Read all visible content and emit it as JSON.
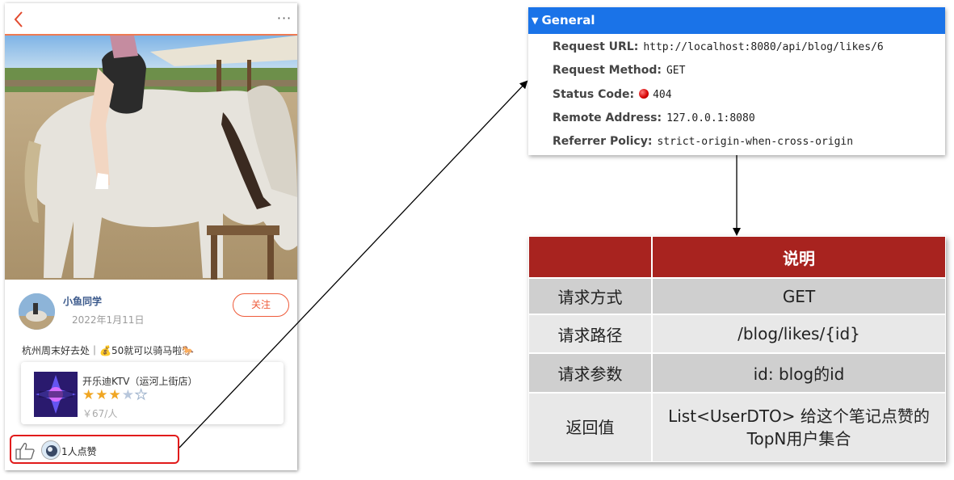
{
  "phone": {
    "more_label": "···",
    "author": "小鱼同学",
    "date": "2022年1月11日",
    "follow_label": "关注",
    "caption": "杭州周末好去处｜💰50就可以骑马啦🐎",
    "shop": {
      "name": "开乐迪KTV（运河上街店）",
      "rating": 3.5,
      "price": "￥67/人"
    },
    "like_text": "1人点赞"
  },
  "general": {
    "title": "General",
    "rows": [
      {
        "key": "Request URL:",
        "value": "http://localhost:8080/api/blog/likes/6"
      },
      {
        "key": "Request Method:",
        "value": "GET"
      },
      {
        "key": "Status Code:",
        "value": "404"
      },
      {
        "key": "Remote Address:",
        "value": "127.0.0.1:8080"
      },
      {
        "key": "Referrer Policy:",
        "value": "strict-origin-when-cross-origin"
      }
    ],
    "status_color": "#d40000",
    "header_color": "#1a73e8"
  },
  "table": {
    "header": [
      "",
      "说明"
    ],
    "rows": [
      [
        "请求方式",
        "GET"
      ],
      [
        "请求路径",
        "/blog/likes/{id}"
      ],
      [
        "请求参数",
        "id: blog的id"
      ],
      [
        "返回值",
        "List<UserDTO> 给这个笔记点赞的TopN用户集合"
      ]
    ],
    "header_color": "#a8231f"
  }
}
